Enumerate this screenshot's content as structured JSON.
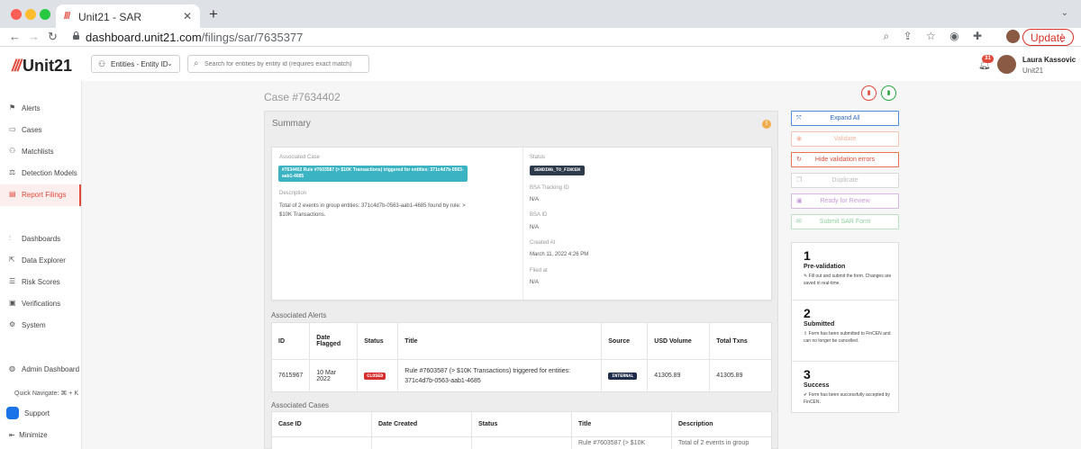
{
  "browser": {
    "tab_title": "Unit21 - SAR",
    "tab_logo": "///",
    "url_host": "dashboard.unit21.com",
    "url_path": "/filings/sar/7635377",
    "update_label": "Update"
  },
  "header": {
    "logo_mark": "///",
    "logo_text": "Unit21",
    "entity_select": "Entities - Entity ID",
    "search_placeholder": "Search for entities by entity id (requires exact match)",
    "notification_count": "31",
    "user_name": "Laura Kassovic",
    "user_org": "Unit21"
  },
  "sidebar": {
    "items": [
      {
        "label": "Alerts",
        "icon": "flag-icon"
      },
      {
        "label": "Cases",
        "icon": "folder-icon"
      },
      {
        "label": "Matchlists",
        "icon": "user-plus-icon"
      },
      {
        "label": "Detection Models",
        "icon": "scale-icon"
      },
      {
        "label": "Report Filings",
        "icon": "file-icon"
      },
      {
        "label": "Dashboards",
        "icon": "chart-icon"
      },
      {
        "label": "Data Explorer",
        "icon": "external-icon"
      },
      {
        "label": "Risk Scores",
        "icon": "list-icon"
      },
      {
        "label": "Verifications",
        "icon": "id-card-icon"
      },
      {
        "label": "System",
        "icon": "gear-icon"
      },
      {
        "label": "Admin Dashboard",
        "icon": "globe-icon"
      }
    ],
    "quick_navigate": "Quick Navigate: ⌘ + K",
    "support": "Support",
    "minimize": "Minimize"
  },
  "case": {
    "title": "Case #7634402",
    "summary_title": "Summary",
    "associated_case_label": "Associated Case",
    "associated_case_value": "#7634402 Rule #7603587 (> $10K Transactions) triggered for entities: 371c4d7b-0563-aab1-4685",
    "description_label": "Description",
    "description_value": "Total of 2 events in group entities: 371c4d7b-0563-aab1-4685 found by rule: > $10K Transactions.",
    "status_label": "Status",
    "status_value": "SENDING_TO_FINCEN",
    "bsa_tracking_label": "BSA Tracking ID",
    "bsa_tracking_value": "N/A",
    "bsa_id_label": "BSA ID",
    "bsa_id_value": "N/A",
    "created_at_label": "Created At",
    "created_at_value": "March 11, 2022 4:26 PM",
    "filed_at_label": "Filed at",
    "filed_at_value": "N/A"
  },
  "alerts": {
    "section_label": "Associated Alerts",
    "headers": [
      "ID",
      "Date Flagged",
      "Status",
      "Title",
      "Source",
      "USD Volume",
      "Total Txns"
    ],
    "rows": [
      {
        "id": "7615967",
        "date": "10 Mar 2022",
        "status": "CLOSED",
        "title": "Rule #7603587 (> $10K Transactions) triggered for entities: 371c4d7b-0563-aab1-4685",
        "source": "INTERNAL",
        "usd_volume": "41305.89",
        "total_txns": "41305.89"
      }
    ]
  },
  "cases_table": {
    "section_label": "Associated Cases",
    "headers": [
      "Case ID",
      "Date Created",
      "Status",
      "Title",
      "Description"
    ],
    "partial_row": {
      "title": "Rule #7603587 (> $10K",
      "description": "Total of 2 events in group"
    }
  },
  "actions": {
    "expand_all": "Expand All",
    "validate": "Validate",
    "hide_errors": "Hide validation errors",
    "duplicate": "Duplicate",
    "ready_review": "Ready for Review",
    "submit": "Submit SAR Form"
  },
  "steps": [
    {
      "num": "1",
      "title": "Pre-validation",
      "desc": "Fill out and submit the form. Changes are saved in real-time.",
      "icon": "pencil-icon"
    },
    {
      "num": "2",
      "title": "Submitted",
      "desc": "Form has been submitted to FinCEN and can no longer be cancelled.",
      "icon": "upload-icon"
    },
    {
      "num": "3",
      "title": "Success",
      "desc": "Form has been successfully accepted by FinCEN.",
      "icon": "check-icon"
    }
  ]
}
